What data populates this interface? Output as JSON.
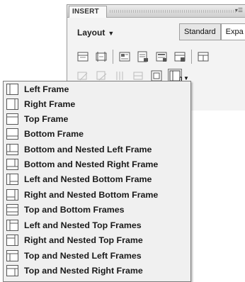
{
  "panel": {
    "tab_label": "INSERT",
    "category_label": "Layout",
    "view_tabs": [
      "Standard",
      "Expa"
    ]
  },
  "frames_menu": {
    "items": [
      "Left Frame",
      "Right Frame",
      "Top Frame",
      "Bottom Frame",
      "Bottom and Nested Left Frame",
      "Bottom and Nested Right Frame",
      "Left and Nested Bottom Frame",
      "Right and Nested Bottom Frame",
      "Top and Bottom Frames",
      "Left and Nested Top Frames",
      "Right and Nested Top Frame",
      "Top and Nested Left Frames",
      "Top and Nested Right Frame"
    ]
  },
  "colors": {
    "menu_background": "#f0f0f0",
    "panel_background": "#f3f3f3",
    "icon_stroke": "#555555"
  }
}
